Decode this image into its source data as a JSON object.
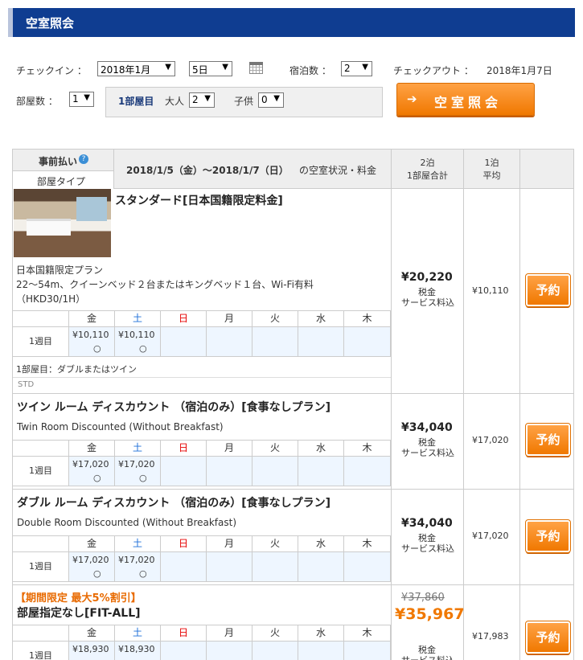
{
  "header": {
    "title": "空室照会"
  },
  "search": {
    "checkin_label": "チェックイン ：",
    "month_value": "2018年1月",
    "day_value": "5日",
    "nights_label": "宿泊数 ：",
    "nights_value": "2",
    "checkout_label": "チェックアウト ：",
    "checkout_value": "2018年1月7日",
    "rooms_label": "部屋数 ：",
    "rooms_value": "1",
    "room1_label": "1部屋目",
    "adults_label": "大人",
    "adults_value": "2",
    "children_label": "子供",
    "children_value": "0",
    "search_button": "空室照会",
    "arrow": "➔"
  },
  "table_header": {
    "prepay": "事前払い",
    "help": "?",
    "room_type": "部屋タイプ",
    "period": "2018/1/5（金）〜2018/1/7（日）",
    "period_suffix": "の空室状況・料金",
    "total_l1": "2泊",
    "total_l2": "1部屋合計",
    "avg_l1": "1泊",
    "avg_l2": "平均"
  },
  "weekdays": [
    "金",
    "土",
    "日",
    "月",
    "火",
    "水",
    "木"
  ],
  "weekday_colors": [
    "#333333",
    "#1e6fd9",
    "#e60000",
    "#333333",
    "#333333",
    "#333333",
    "#333333"
  ],
  "week_label": "1週目",
  "avail_mark": "○",
  "tax_l1": "税金",
  "tax_l2": "サービス料込",
  "book_label": "予約",
  "plans": [
    {
      "title": "スタンダード[日本国籍限定料金]",
      "desc1": "日本国籍限定プラン",
      "desc2": "22〜54m、クイーンベッド２台またはキングベッド１台、Wi-Fi有料",
      "desc3": "（HKD30/1H）",
      "prices": [
        "¥10,110",
        "¥10,110"
      ],
      "note": "1部屋目：ダブルまたはツイン",
      "code": "STD",
      "total": "¥20,220",
      "avg": "¥10,110"
    },
    {
      "title": "ツイン ルーム ディスカウント （宿泊のみ）[食事なしプラン]",
      "desc1": "Twin Room Discounted (Without Breakfast)",
      "prices": [
        "¥17,020",
        "¥17,020"
      ],
      "total": "¥34,040",
      "avg": "¥17,020"
    },
    {
      "title": "ダブル ルーム ディスカウント （宿泊のみ）[食事なしプラン]",
      "desc1": "Double Room Discounted (Without Breakfast)",
      "prices": [
        "¥17,020",
        "¥17,020"
      ],
      "total": "¥34,040",
      "avg": "¥17,020"
    },
    {
      "promo": "【期間限定 最大5%割引】",
      "title": "部屋指定なし[FIT-ALL]",
      "prices": [
        "¥18,930",
        "¥18,930"
      ],
      "original_total": "¥37,860",
      "total": "¥35,967",
      "avg": "¥17,983"
    }
  ]
}
